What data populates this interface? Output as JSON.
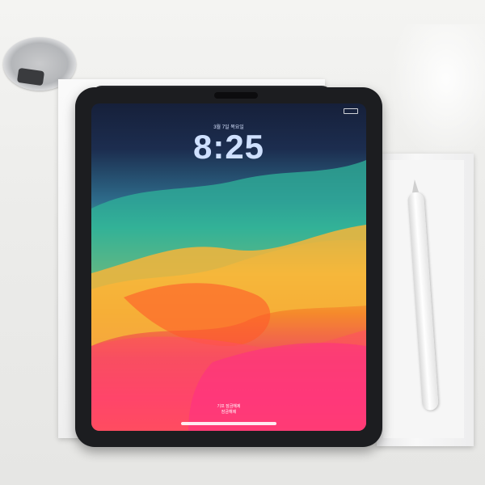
{
  "lockscreen": {
    "date": "3월 7일 목요일",
    "time": "8:25",
    "hint_line1": "기프 잠금해제",
    "hint_line2": "잠금해제"
  },
  "colors": {
    "tablet_bezel": "#1c1d20",
    "wallpaper_orange": "#f58a2b",
    "wallpaper_pink": "#ff3a73",
    "wallpaper_teal": "#3fae8f"
  }
}
